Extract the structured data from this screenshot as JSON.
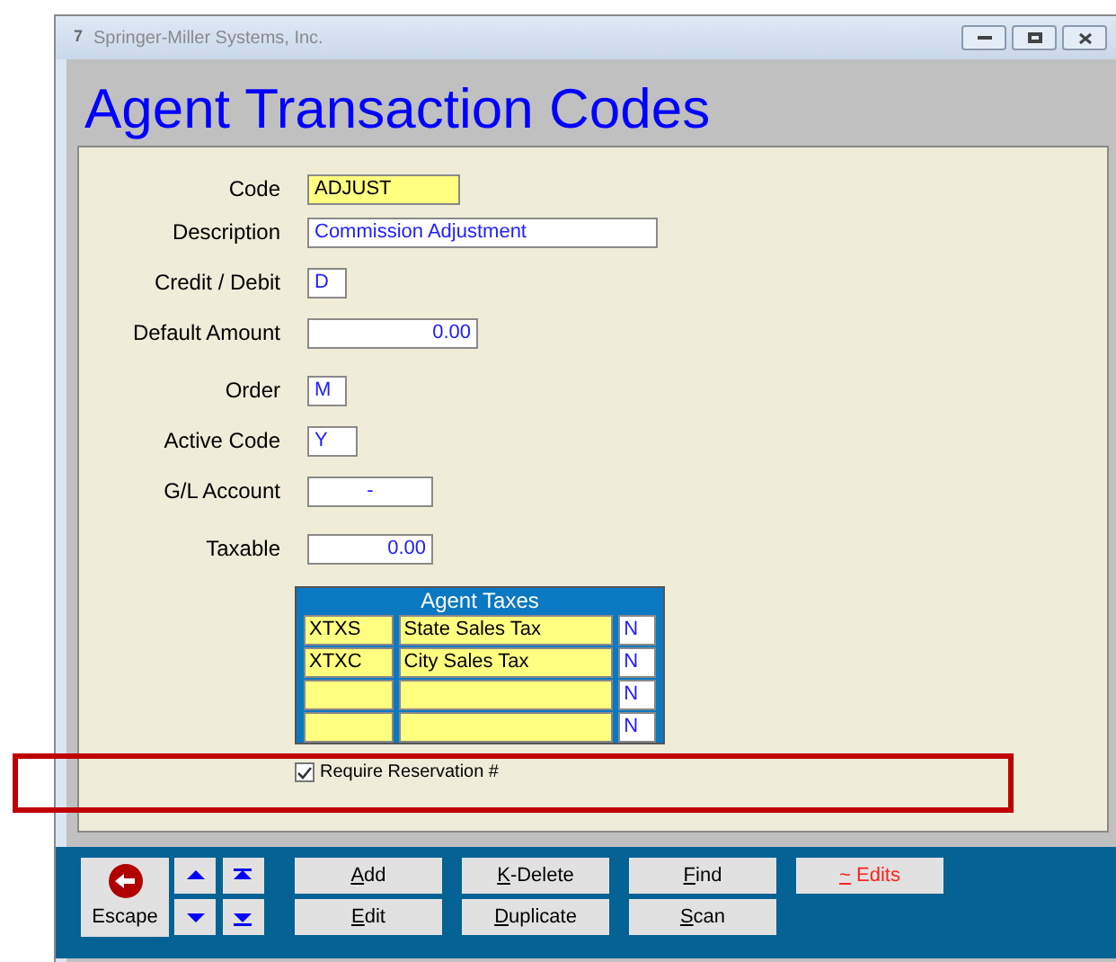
{
  "window": {
    "app_number": "7",
    "title": "Springer-Miller Systems, Inc."
  },
  "heading": "Agent Transaction Codes",
  "fields": [
    {
      "label": "Code",
      "value": "ADJUST",
      "kind": "key"
    },
    {
      "label": "Description",
      "value": "Commission Adjustment",
      "kind": "text"
    },
    {
      "label": "Credit / Debit",
      "value": "D",
      "kind": "text"
    },
    {
      "label": "Default Amount",
      "value": "0.00",
      "kind": "amount"
    },
    {
      "label": "Order",
      "value": "M",
      "kind": "text"
    },
    {
      "label": "Active Code",
      "value": "Y",
      "kind": "text"
    },
    {
      "label": "G/L Account",
      "value": "-",
      "kind": "center"
    },
    {
      "label": "Taxable",
      "value": "0.00",
      "kind": "amount"
    }
  ],
  "agent_taxes": {
    "title": "Agent Taxes",
    "rows": [
      {
        "code": "XTXS",
        "name": "State Sales Tax",
        "flag": "N"
      },
      {
        "code": "XTXC",
        "name": "City Sales Tax",
        "flag": "N"
      },
      {
        "code": "",
        "name": "",
        "flag": "N"
      },
      {
        "code": "",
        "name": "",
        "flag": "N"
      }
    ]
  },
  "require_reservation": {
    "label": "Require Reservation #",
    "checked": true
  },
  "toolbar": {
    "escape": "Escape",
    "columns": [
      [
        {
          "key": "A",
          "rest": "dd",
          "kind": "normal"
        },
        {
          "key": "E",
          "rest": "dit",
          "kind": "normal"
        }
      ],
      [
        {
          "key": "K",
          "rest": "-Delete",
          "kind": "normal"
        },
        {
          "key": "D",
          "rest": "uplicate",
          "kind": "normal"
        }
      ],
      [
        {
          "key": "F",
          "rest": "ind",
          "kind": "normal"
        },
        {
          "key": "S",
          "rest": "can",
          "kind": "normal"
        }
      ],
      [
        {
          "key": "~",
          "rest": " Edits",
          "kind": "alert"
        }
      ]
    ]
  }
}
